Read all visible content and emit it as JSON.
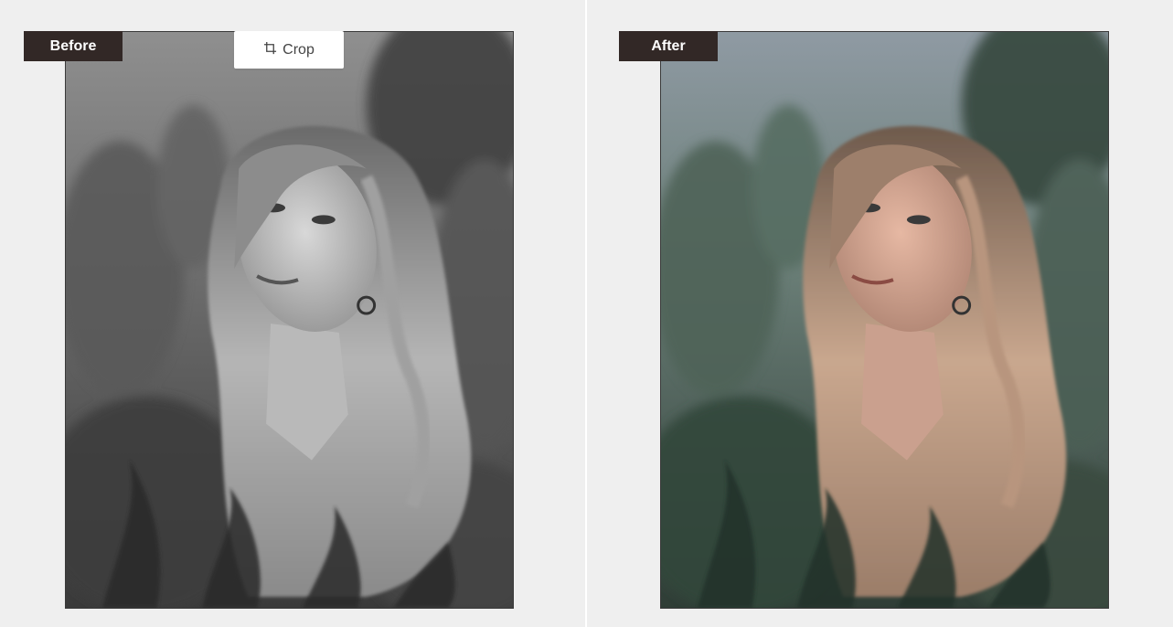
{
  "before_panel": {
    "tag_label": "Before",
    "crop_button_label": "Crop",
    "crop_icon": "crop-icon"
  },
  "after_panel": {
    "tag_label": "After"
  },
  "colors": {
    "background": "#efefef",
    "tag_bg": "#322826",
    "tag_text": "#ffffff",
    "divider": "#ffffff",
    "crop_btn_bg": "#ffffff",
    "crop_btn_text": "#444444"
  }
}
